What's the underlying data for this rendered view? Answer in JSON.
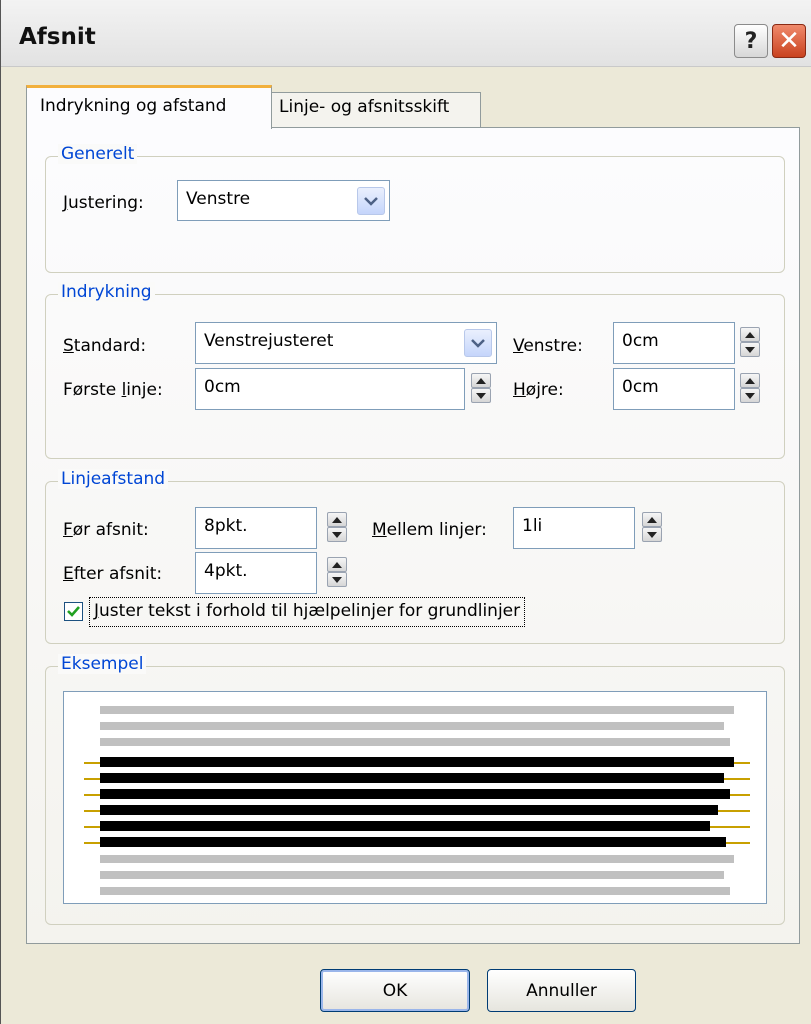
{
  "window": {
    "title": "Afsnit",
    "help_label": "?",
    "close_label": "✕"
  },
  "tabs": [
    {
      "label": "Indrykning og afstand",
      "selected": true
    },
    {
      "label": "Linje- og afsnitsskift",
      "selected": false
    }
  ],
  "general": {
    "legend": "Generelt",
    "alignment_label_first": "J",
    "alignment_label_rest": "ustering:",
    "alignment_value": "Venstre"
  },
  "indent": {
    "legend": "Indrykning",
    "standard_label_first": "S",
    "standard_label_rest": "tandard:",
    "standard_value": "Venstrejusteret",
    "first_line_label_pre": "Første ",
    "first_line_label_u": "l",
    "first_line_label_post": "inje:",
    "first_line_value": "0cm",
    "left_label_first": "V",
    "left_label_rest": "enstre:",
    "left_value": "0cm",
    "right_label_first": "H",
    "right_label_rest": "øjre:",
    "right_value": "0cm"
  },
  "spacing": {
    "legend": "Linjeafstand",
    "before_label_first": "F",
    "before_label_rest": "ør afsnit:",
    "before_value": "8pkt.",
    "after_label_first": "E",
    "after_label_rest": "fter afsnit:",
    "after_value": "4pkt.",
    "between_label_first": "M",
    "between_label_rest": "ellem linjer:",
    "between_value": "1li",
    "snap_checked": true,
    "snap_label_first": "J",
    "snap_label_rest": "uster tekst i forhold til hjælpelinjer for grundlinjer"
  },
  "example": {
    "legend": "Eksempel"
  },
  "buttons": {
    "ok": "OK",
    "cancel": "Annuller"
  },
  "colors": {
    "legend_text": "#0046d5",
    "tab_highlight": "#f2b03c",
    "preview_gray": "#c0c0c0",
    "preview_black": "#000000",
    "baseline_gold": "#c8a000",
    "close_red": "#c9421f"
  }
}
